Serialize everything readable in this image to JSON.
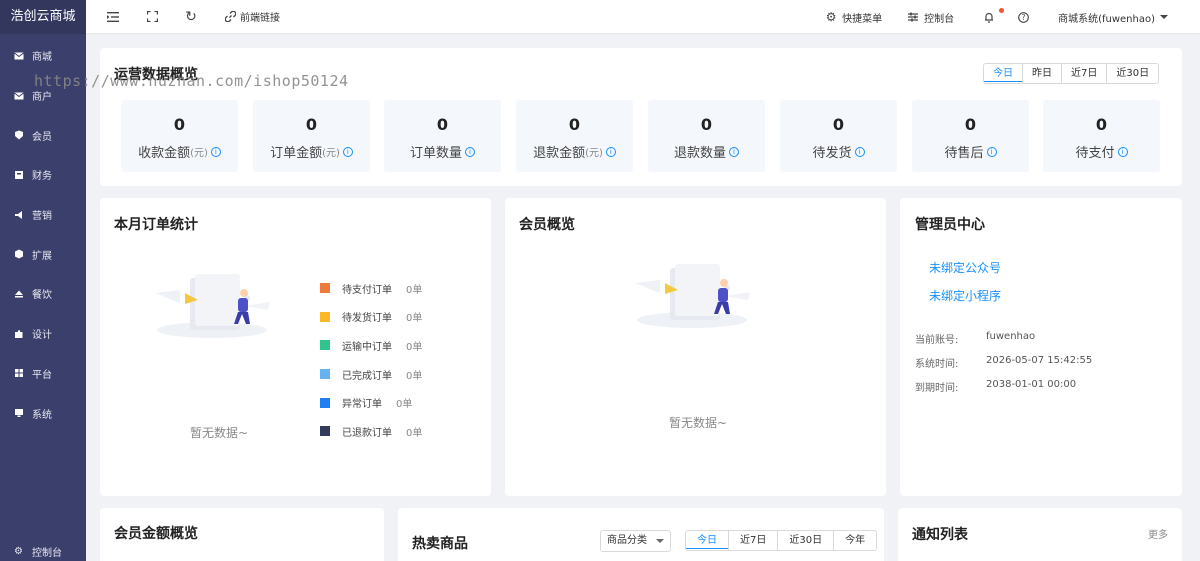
{
  "brand": "浩创云商城",
  "sidebar": {
    "items": [
      {
        "label": "商城",
        "icon": "envelope-icon"
      },
      {
        "label": "商户",
        "icon": "envelope-icon"
      },
      {
        "label": "会员",
        "icon": "tag-icon"
      },
      {
        "label": "财务",
        "icon": "wallet-icon"
      },
      {
        "label": "营销",
        "icon": "megaphone-icon"
      },
      {
        "label": "扩展",
        "icon": "cube-icon"
      },
      {
        "label": "餐饮",
        "icon": "eject-icon"
      },
      {
        "label": "设计",
        "icon": "puzzle-icon"
      },
      {
        "label": "平台",
        "icon": "grid-icon"
      },
      {
        "label": "系统",
        "icon": "monitor-icon"
      }
    ],
    "bottom": "控制台"
  },
  "topbar": {
    "frontend_link": "前端链接",
    "quick_menu": "快捷菜单",
    "console": "控制台",
    "account": "商城系统(fuwenhao)"
  },
  "watermark": "https://www.huzhan.com/ishop50124",
  "overview": {
    "title": "运营数据概览",
    "tabs": [
      "今日",
      "昨日",
      "近7日",
      "近30日"
    ],
    "active_tab": "今日",
    "stats": [
      {
        "value": "0",
        "label": "收款金额",
        "unit": "(元)"
      },
      {
        "value": "0",
        "label": "订单金额",
        "unit": "(元)"
      },
      {
        "value": "0",
        "label": "订单数量",
        "unit": ""
      },
      {
        "value": "0",
        "label": "退款金额",
        "unit": "(元)"
      },
      {
        "value": "0",
        "label": "退款数量",
        "unit": ""
      },
      {
        "value": "0",
        "label": "待发货",
        "unit": ""
      },
      {
        "value": "0",
        "label": "待售后",
        "unit": ""
      },
      {
        "value": "0",
        "label": "待支付",
        "unit": ""
      }
    ]
  },
  "monthly_orders": {
    "title": "本月订单统计",
    "empty": "暂无数据~",
    "legend": [
      {
        "label": "待支付订单",
        "count": "0单",
        "color": "#ee7a3a"
      },
      {
        "label": "待发货订单",
        "count": "0单",
        "color": "#fbb829"
      },
      {
        "label": "运输中订单",
        "count": "0单",
        "color": "#2ec48b"
      },
      {
        "label": "已完成订单",
        "count": "0单",
        "color": "#64b2f2"
      },
      {
        "label": "异常订单",
        "count": "0单",
        "color": "#1f7ff0"
      },
      {
        "label": "已退款订单",
        "count": "0单",
        "color": "#333a5c"
      }
    ]
  },
  "member_overview": {
    "title": "会员概览",
    "empty": "暂无数据~"
  },
  "admin_center": {
    "title": "管理员中心",
    "links": [
      "未绑定公众号",
      "未绑定小程序"
    ],
    "info": [
      {
        "key": "当前账号:",
        "value": "fuwenhao"
      },
      {
        "key": "系统时间:",
        "value": "2026-05-07 15:42:55"
      },
      {
        "key": "到期时间:",
        "value": "2038-01-01 00:00"
      }
    ]
  },
  "member_amount": {
    "title": "会员金额概览"
  },
  "hot_products": {
    "title": "热卖商品",
    "category_select": "商品分类",
    "tabs": [
      "今日",
      "近7日",
      "近30日",
      "今年"
    ],
    "active_tab": "今日"
  },
  "notifications": {
    "title": "通知列表",
    "more": "更多"
  },
  "colors": {
    "sidebar": "#3b3f6b",
    "accent": "#1890ff"
  }
}
